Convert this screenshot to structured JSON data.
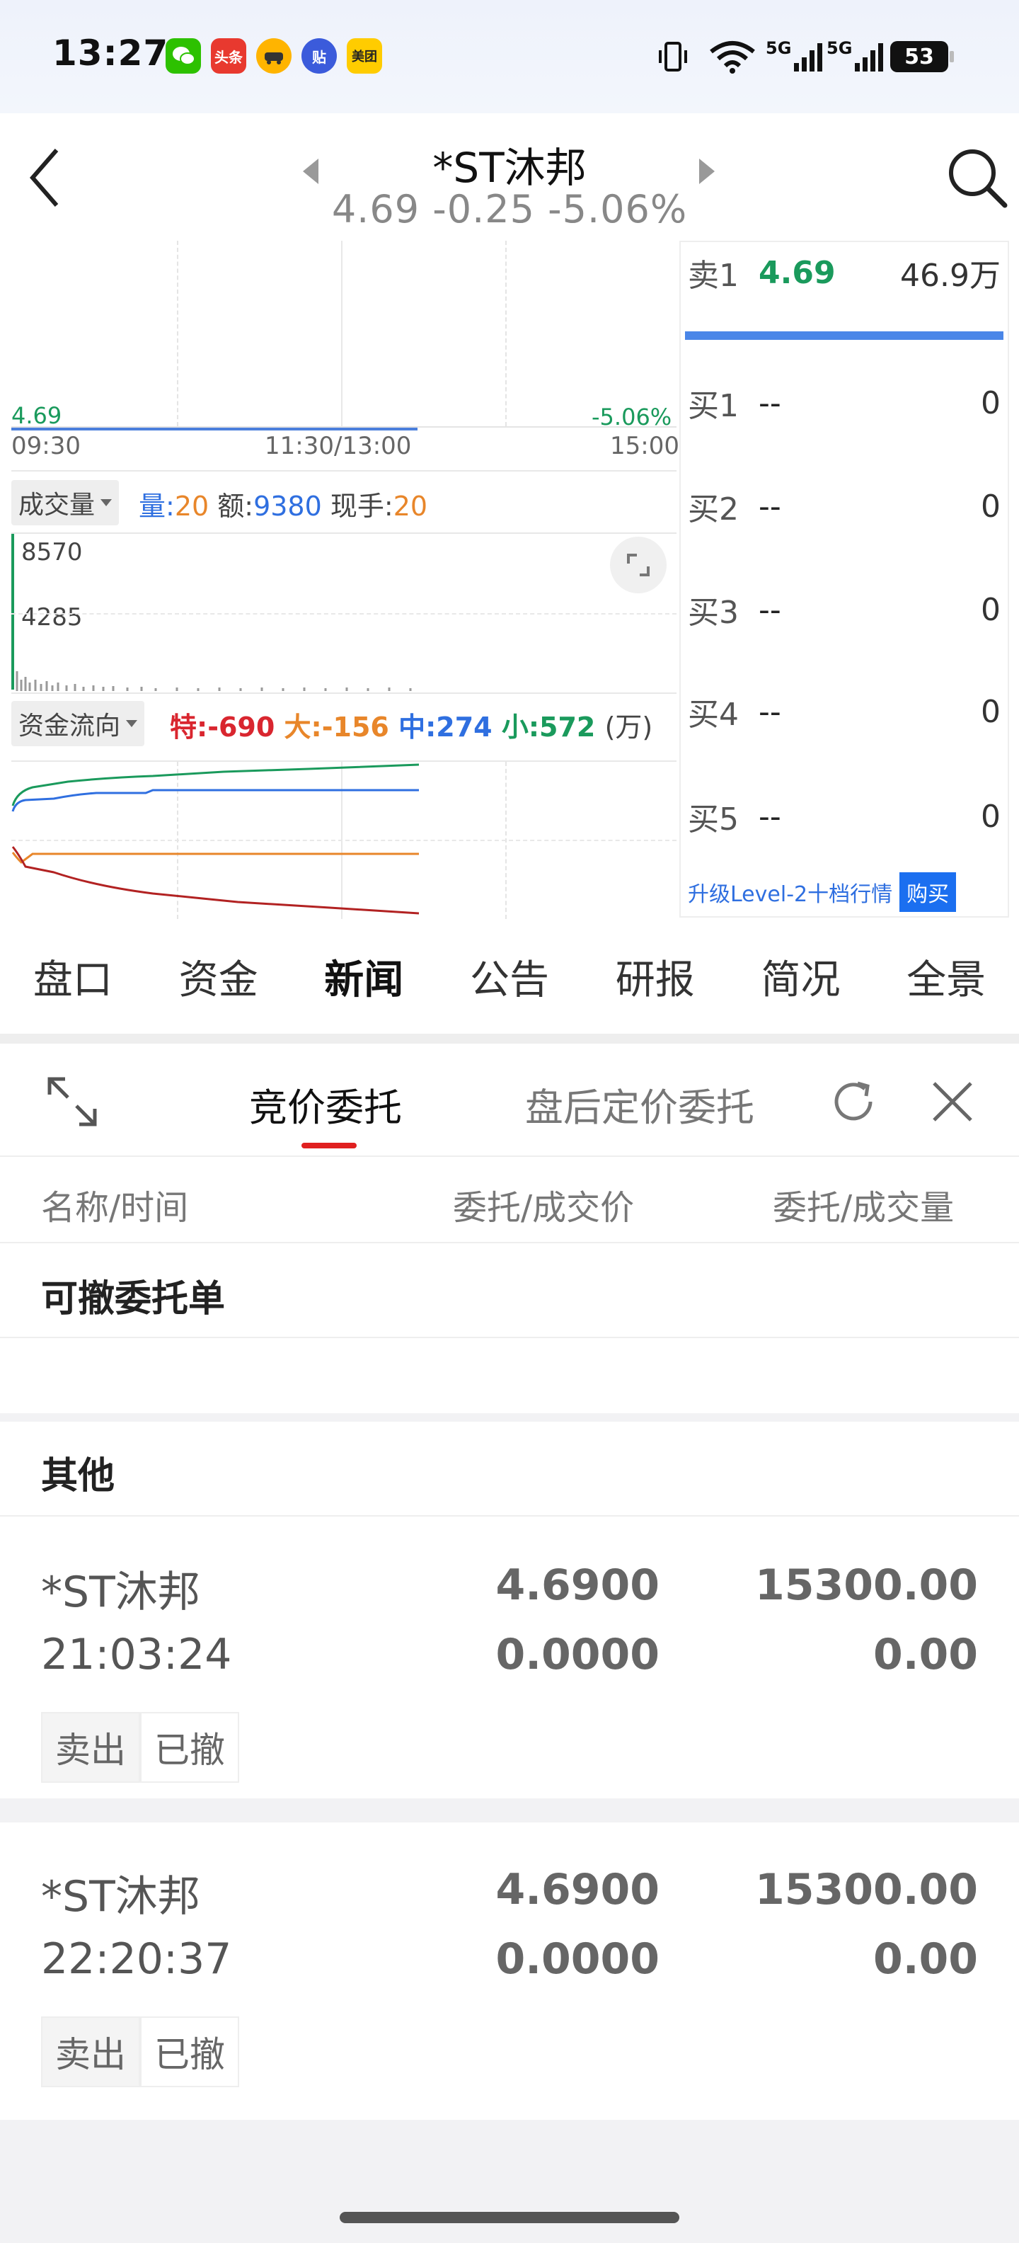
{
  "status_bar": {
    "time": "13:27",
    "apps": [
      {
        "icon": "wechat-icon",
        "color": "#2dc100",
        "text": ""
      },
      {
        "icon": "toutiao-icon",
        "color": "#e8392f",
        "text": "头条"
      },
      {
        "icon": "taxi-icon",
        "color": "#ffb400",
        "text": ""
      },
      {
        "icon": "tieba-icon",
        "color": "#3b5bdb",
        "text": "贴"
      },
      {
        "icon": "meituan-icon",
        "color": "#ffcc00",
        "text": "美团"
      }
    ],
    "network_5g_a": "5G",
    "network_5g_b": "5G",
    "battery": "53"
  },
  "header": {
    "stock_name": "*ST沐邦",
    "quote": "4.69  -0.25  -5.06%"
  },
  "chart": {
    "price_left": "4.69",
    "pct_right": "-5.06%",
    "time_start": "09:30",
    "time_mid": "11:30/13:00",
    "time_end": "15:00",
    "volume_select": "成交量",
    "vol_label_qty": "量:",
    "vol_qty": "20",
    "vol_label_amt": "额:",
    "vol_amt": "9380",
    "vol_label_hand": "现手:",
    "vol_hand": "20",
    "vol_axis_top": "8570",
    "vol_axis_mid": "4285",
    "flow_select": "资金流向",
    "flow_te_label": "特:",
    "flow_te": "-690",
    "flow_da_label": "大:",
    "flow_da": "-156",
    "flow_zhong_label": "中:",
    "flow_zhong": "274",
    "flow_xiao_label": "小:",
    "flow_xiao": "572",
    "flow_unit": "(万)",
    "colors": {
      "green": "#1a9a5c",
      "red": "#d9262f",
      "blue": "#2f6fe0",
      "orange": "#e8862a"
    }
  },
  "order_book": {
    "sell": [
      {
        "label": "卖1",
        "price": "4.69",
        "volume": "46.9万"
      }
    ],
    "buy": [
      {
        "label": "买1",
        "price": "--",
        "volume": "0"
      },
      {
        "label": "买2",
        "price": "--",
        "volume": "0"
      },
      {
        "label": "买3",
        "price": "--",
        "volume": "0"
      },
      {
        "label": "买4",
        "price": "--",
        "volume": "0"
      },
      {
        "label": "买5",
        "price": "--",
        "volume": "0"
      }
    ],
    "level2_text": "升级Level-2十档行情",
    "buy_button": "购买"
  },
  "tabs": [
    "盘口",
    "资金",
    "新闻",
    "公告",
    "研报",
    "简况",
    "全景"
  ],
  "active_tab": "新闻",
  "panel": {
    "tab_active": "竞价委托",
    "tab_inactive": "盘后定价委托",
    "col_name": "名称/时间",
    "col_price": "委托/成交价",
    "col_qty": "委托/成交量",
    "section_cancelable": "可撤委托单",
    "section_other": "其他",
    "orders": [
      {
        "name": "*ST沐邦",
        "time": "21:03:24",
        "order_price": "4.6900",
        "deal_price": "0.0000",
        "order_qty": "15300.00",
        "deal_qty": "0.00",
        "side": "卖出",
        "status": "已撤"
      },
      {
        "name": "*ST沐邦",
        "time": "22:20:37",
        "order_price": "4.6900",
        "deal_price": "0.0000",
        "order_qty": "15300.00",
        "deal_qty": "0.00",
        "side": "卖出",
        "status": "已撤"
      }
    ]
  }
}
